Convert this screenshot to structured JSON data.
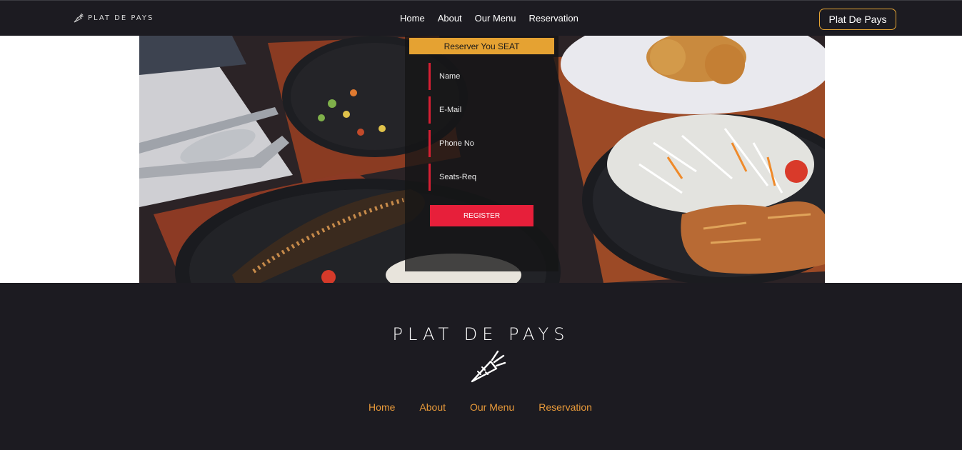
{
  "navbar": {
    "brand": "PLAT DE PAYS",
    "links": [
      "Home",
      "About",
      "Our Menu",
      "Reservation"
    ],
    "button": "Plat De Pays"
  },
  "reservation": {
    "heading": "Reserver You SEAT",
    "fields": {
      "name": "Name",
      "email": "E-Mail",
      "phone": "Phone No",
      "seats": "Seats-Req"
    },
    "submit": "REGISTER"
  },
  "footer": {
    "title": "PLAT DE PAYS",
    "links": [
      "Home",
      "About",
      "Our Menu",
      "Reservation"
    ]
  },
  "icons": {
    "logo": "carrot-icon"
  },
  "colors": {
    "accent": "#e5a232",
    "danger": "#e71f3a",
    "dark": "#1c1b21",
    "footer_link": "#e89a3a"
  }
}
